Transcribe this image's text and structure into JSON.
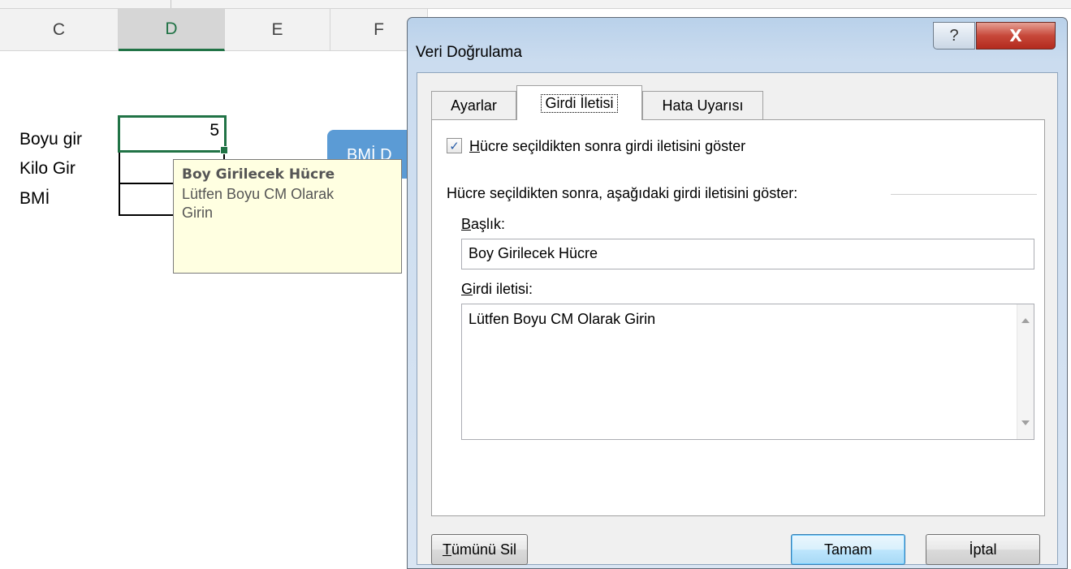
{
  "spreadsheet": {
    "columns": [
      {
        "label": "C",
        "selected": false
      },
      {
        "label": "D",
        "selected": true
      },
      {
        "label": "E",
        "selected": false
      },
      {
        "label": "F",
        "selected": false
      }
    ],
    "labels": {
      "row1": "Boyu gir",
      "row2": "Kilo Gir",
      "row3": "BMİ"
    },
    "active_cell_value": "5",
    "shape_button_text": "BMİ D",
    "input_tooltip": {
      "title": "Boy Girilecek Hücre",
      "line1": "Lütfen Boyu CM Olarak",
      "line2": "Girin"
    }
  },
  "dialog": {
    "title": "Veri Doğrulama",
    "help_glyph": "?",
    "close_glyph": "X",
    "tabs": [
      {
        "label": "Ayarlar",
        "active": false
      },
      {
        "label": "Girdi İletisi",
        "active": true
      },
      {
        "label": "Hata Uyarısı",
        "active": false
      }
    ],
    "show_message_checkbox": {
      "checked": true,
      "mark": "✓",
      "label_first": "H",
      "label_rest": "ücre seçildikten sonra girdi iletisini göster"
    },
    "group_label": "Hücre seçildikten sonra, aşağıdaki girdi iletisini göster:",
    "title_field": {
      "label_first": "B",
      "label_rest": "aşlık:",
      "value": "Boy Girilecek Hücre"
    },
    "message_field": {
      "label_first": "G",
      "label_rest": "irdi iletisi:",
      "value": "Lütfen Boyu CM Olarak Girin"
    },
    "buttons": {
      "clear_first": "T",
      "clear_rest": "ümünü Sil",
      "ok": "Tamam",
      "cancel": "İptal"
    }
  }
}
